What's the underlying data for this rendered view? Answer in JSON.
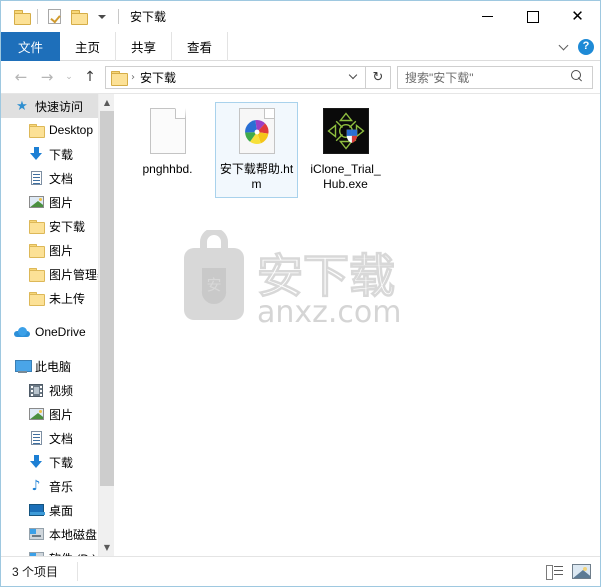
{
  "window": {
    "title": "安下载",
    "quick_access_icons": [
      "folder-icon",
      "properties-icon",
      "new-folder-icon",
      "customize-caret-icon"
    ],
    "controls": {
      "minimize": "—",
      "maximize": "□",
      "close": "✕"
    }
  },
  "ribbon": {
    "tabs": [
      {
        "label": "文件",
        "active": true
      },
      {
        "label": "主页",
        "active": false
      },
      {
        "label": "共享",
        "active": false
      },
      {
        "label": "查看",
        "active": false
      }
    ],
    "collapse_icon": "chevron-down-icon",
    "help_label": "?"
  },
  "addressbar": {
    "back": "←",
    "forward": "→",
    "history": "⌄",
    "up": "↑",
    "breadcrumb_folder_icon": "folder-icon",
    "breadcrumb_separator": "›",
    "breadcrumb_label": "安下载",
    "dropdown_icon": "chevron-down-icon",
    "refresh": "↻",
    "refresh_icon": "refresh-icon"
  },
  "search": {
    "placeholder": "搜索\"安下载\"",
    "icon": "search-icon"
  },
  "sidebar": {
    "items": [
      {
        "label": "快速访问",
        "icon": "star-icon",
        "level": 0,
        "selected": true,
        "pinned": false
      },
      {
        "label": "Desktop",
        "icon": "folder-icon",
        "level": 1,
        "selected": false,
        "pinned": true
      },
      {
        "label": "下载",
        "icon": "download-icon",
        "level": 1,
        "selected": false,
        "pinned": true
      },
      {
        "label": "文档",
        "icon": "documents-icon",
        "level": 1,
        "selected": false,
        "pinned": true
      },
      {
        "label": "图片",
        "icon": "pictures-icon",
        "level": 1,
        "selected": false,
        "pinned": true
      },
      {
        "label": "安下载",
        "icon": "folder-icon",
        "level": 1,
        "selected": false,
        "pinned": false
      },
      {
        "label": "图片",
        "icon": "folder-icon",
        "level": 1,
        "selected": false,
        "pinned": false
      },
      {
        "label": "图片管理器",
        "icon": "folder-icon",
        "level": 1,
        "selected": false,
        "pinned": false
      },
      {
        "label": "未上传",
        "icon": "folder-icon",
        "level": 1,
        "selected": false,
        "pinned": false
      },
      {
        "label": "OneDrive",
        "icon": "cloud-icon",
        "level": 0,
        "selected": false,
        "pinned": false
      },
      {
        "label": "此电脑",
        "icon": "computer-icon",
        "level": 0,
        "selected": false,
        "pinned": false
      },
      {
        "label": "视频",
        "icon": "video-icon",
        "level": 1,
        "selected": false,
        "pinned": false
      },
      {
        "label": "图片",
        "icon": "pictures-icon",
        "level": 1,
        "selected": false,
        "pinned": false
      },
      {
        "label": "文档",
        "icon": "documents-icon",
        "level": 1,
        "selected": false,
        "pinned": false
      },
      {
        "label": "下载",
        "icon": "download-icon",
        "level": 1,
        "selected": false,
        "pinned": false
      },
      {
        "label": "音乐",
        "icon": "music-icon",
        "level": 1,
        "selected": false,
        "pinned": false
      },
      {
        "label": "桌面",
        "icon": "desktop-icon",
        "level": 1,
        "selected": false,
        "pinned": false
      },
      {
        "label": "本地磁盘 (C",
        "icon": "drive-icon",
        "level": 1,
        "selected": false,
        "pinned": false
      },
      {
        "label": "软件 (D:)",
        "icon": "drive-icon",
        "level": 1,
        "selected": false,
        "pinned": false
      }
    ],
    "scroll_up_icon": "chevron-up-icon",
    "scroll_down_icon": "chevron-down-icon"
  },
  "files": [
    {
      "name": "pnghhbd.",
      "icon": "blank-document-icon",
      "selected": false
    },
    {
      "name": "安下载帮助.htm",
      "icon": "html-document-icon",
      "selected": true
    },
    {
      "name": "iClone_Trial_Hub.exe",
      "icon": "iclone-executable-icon",
      "selected": false
    }
  ],
  "watermark": {
    "text": "安",
    "brand": "安下载",
    "url": "anxz.com"
  },
  "statusbar": {
    "count_text": "3 个项目",
    "views": [
      {
        "icon": "details-view-icon",
        "name": "details-view"
      },
      {
        "icon": "large-icons-view-icon",
        "name": "large-icons-view"
      }
    ]
  }
}
